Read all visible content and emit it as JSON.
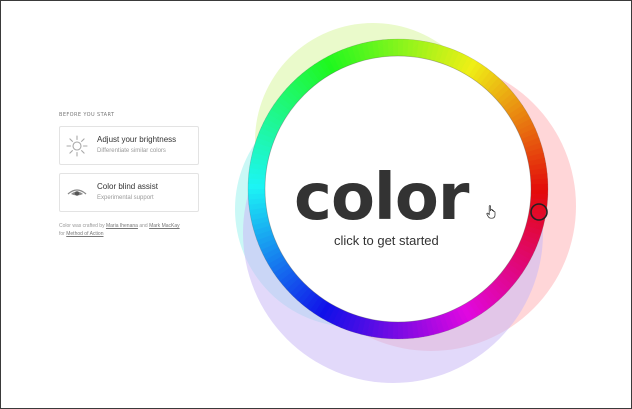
{
  "intro": {
    "section_title": "BEFORE YOU START"
  },
  "cards": [
    {
      "title": "Adjust your brightness",
      "subtitle": "Differentiate similar colors",
      "icon": "sun-icon"
    },
    {
      "title": "Color blind assist",
      "subtitle": "Experimental support",
      "icon": "eye-icon"
    }
  ],
  "credits": {
    "text_before": "Color was crafted by ",
    "author1": "Maria Ihenana",
    "text_mid": " and ",
    "author2": "Mark MacKay",
    "text_for": " for ",
    "org": "Method of Action"
  },
  "hero": {
    "word": "color",
    "cta": "click to get started"
  },
  "colors": {
    "text_dark": "#333333",
    "text_muted": "#999999",
    "card_border": "#e3e3e3"
  }
}
